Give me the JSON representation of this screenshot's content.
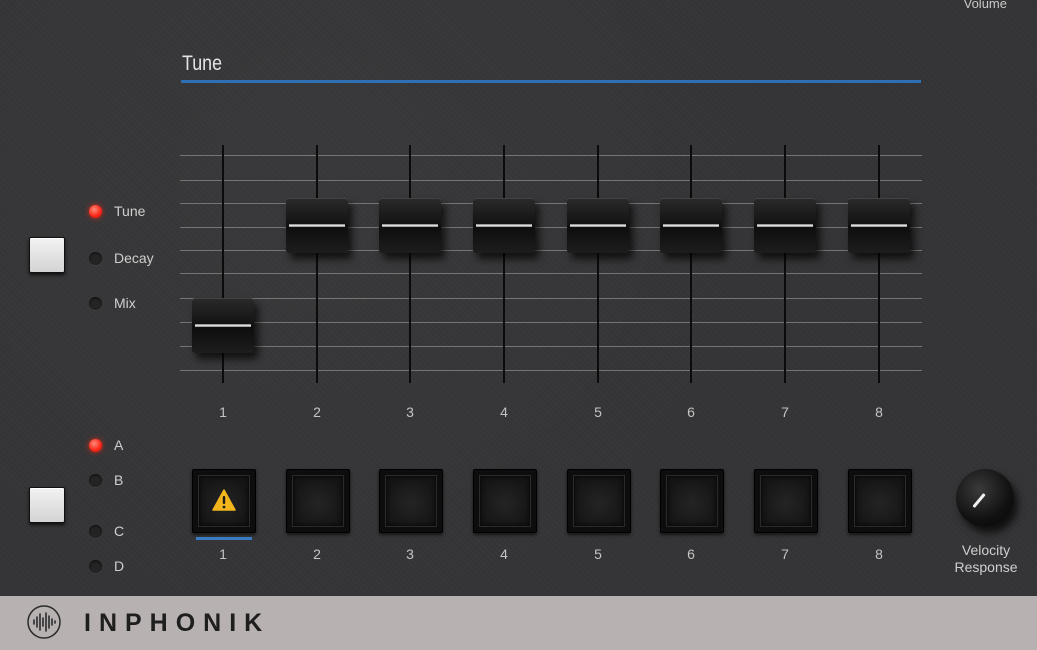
{
  "header": {
    "volume_label": "Volume"
  },
  "section": {
    "title": "Tune"
  },
  "mode_indicators": [
    {
      "label": "Tune",
      "active": true
    },
    {
      "label": "Decay",
      "active": false
    },
    {
      "label": "Mix",
      "active": false
    }
  ],
  "bank_indicators": [
    {
      "label": "A",
      "active": true
    },
    {
      "label": "B",
      "active": false
    },
    {
      "label": "C",
      "active": false
    },
    {
      "label": "D",
      "active": false
    }
  ],
  "faders": [
    {
      "number": "1",
      "level": 0.2
    },
    {
      "number": "2",
      "level": 0.62
    },
    {
      "number": "3",
      "level": 0.62
    },
    {
      "number": "4",
      "level": 0.62
    },
    {
      "number": "5",
      "level": 0.62
    },
    {
      "number": "6",
      "level": 0.62
    },
    {
      "number": "7",
      "level": 0.62
    },
    {
      "number": "8",
      "level": 0.62
    }
  ],
  "pads": [
    {
      "number": "1",
      "selected": true,
      "icon": "warning-icon"
    },
    {
      "number": "2",
      "selected": false
    },
    {
      "number": "3",
      "selected": false
    },
    {
      "number": "4",
      "selected": false
    },
    {
      "number": "5",
      "selected": false
    },
    {
      "number": "6",
      "selected": false
    },
    {
      "number": "7",
      "selected": false
    },
    {
      "number": "8",
      "selected": false
    }
  ],
  "knob": {
    "line1": "Velocity",
    "line2": "Response"
  },
  "footer": {
    "brand": "INPHONIK"
  },
  "colors": {
    "accent": "#2f6fb4",
    "led_on": "#ff2a1a",
    "footer_bg": "#b7b1b1"
  }
}
